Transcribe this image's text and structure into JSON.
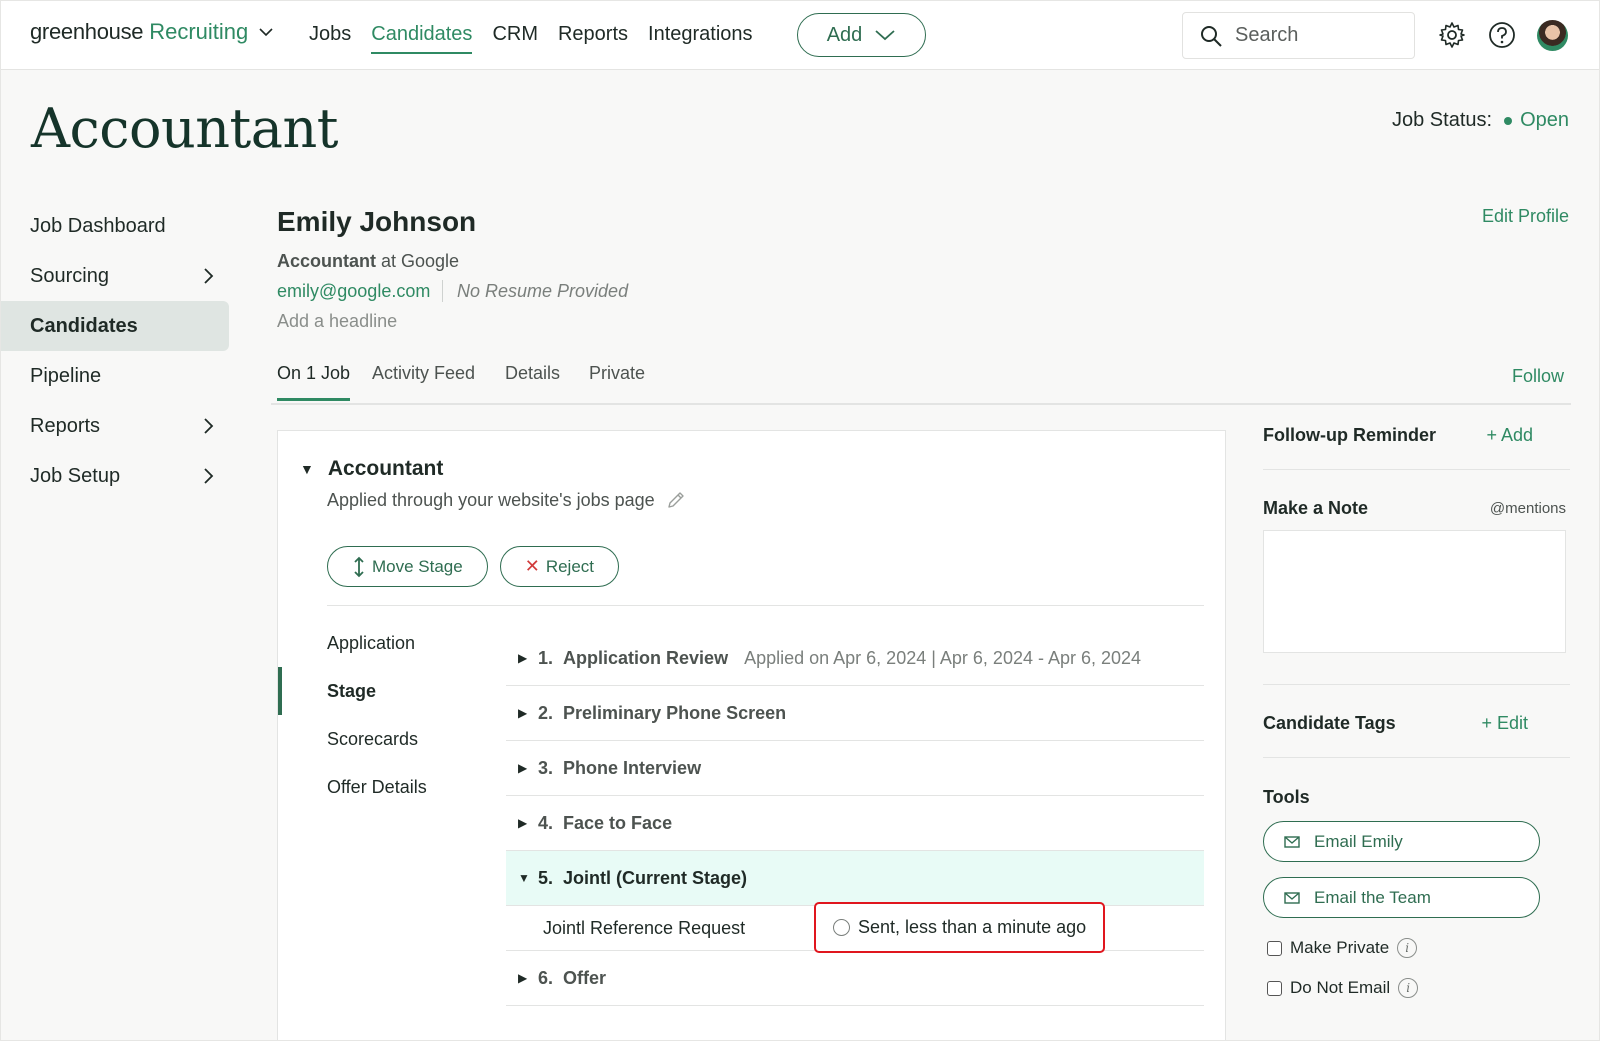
{
  "nav": {
    "brand_main": "greenhouse",
    "brand_product": "Recruiting",
    "links": [
      "Jobs",
      "Candidates",
      "CRM",
      "Reports",
      "Integrations"
    ],
    "add_label": "Add",
    "search_placeholder": "Search"
  },
  "page": {
    "title": "Accountant",
    "job_status_label": "Job Status:",
    "job_status_value": "Open"
  },
  "sidebar": {
    "items": [
      {
        "label": "Job Dashboard"
      },
      {
        "label": "Sourcing"
      },
      {
        "label": "Candidates"
      },
      {
        "label": "Pipeline"
      },
      {
        "label": "Reports"
      },
      {
        "label": "Job Setup"
      }
    ]
  },
  "candidate": {
    "name": "Emily Johnson",
    "role": "Accountant",
    "company": "at Google",
    "email": "emily@google.com",
    "resume_status": "No Resume Provided",
    "headline_placeholder": "Add a headline",
    "edit_profile": "Edit Profile",
    "follow": "Follow"
  },
  "tabs": [
    "On 1 Job",
    "Activity Feed",
    "Details",
    "Private"
  ],
  "application": {
    "job_title": "Accountant",
    "source": "Applied through your website's jobs page",
    "move_stage": "Move Stage",
    "reject": "Reject",
    "subnav": [
      "Application",
      "Stage",
      "Scorecards",
      "Offer Details"
    ],
    "stages": [
      {
        "num": "1.",
        "name": "Application Review",
        "meta": "Applied on Apr 6, 2024 | Apr 6, 2024 - Apr 6, 2024"
      },
      {
        "num": "2.",
        "name": "Preliminary Phone Screen",
        "meta": ""
      },
      {
        "num": "3.",
        "name": "Phone Interview",
        "meta": ""
      },
      {
        "num": "4.",
        "name": "Face to Face",
        "meta": ""
      },
      {
        "num": "5.",
        "name": "Jointl (Current Stage)",
        "meta": ""
      },
      {
        "num": "6.",
        "name": "Offer",
        "meta": ""
      }
    ],
    "reference_label": "Jointl Reference Request",
    "reference_status": "Sent, less than a minute ago"
  },
  "right_panel": {
    "followup_title": "Follow-up Reminder",
    "followup_add": "+ Add",
    "note_title": "Make a Note",
    "note_mentions": "@mentions",
    "tags_title": "Candidate Tags",
    "tags_edit": "+ Edit",
    "tools_title": "Tools",
    "email_candidate": "Email Emily",
    "email_team": "Email the Team",
    "make_private": "Make Private",
    "do_not_email": "Do Not Email"
  },
  "colors": {
    "brand_green": "#2f8a63",
    "current_stage_bg": "#e8fbf6",
    "highlight_red": "#e0161e"
  }
}
